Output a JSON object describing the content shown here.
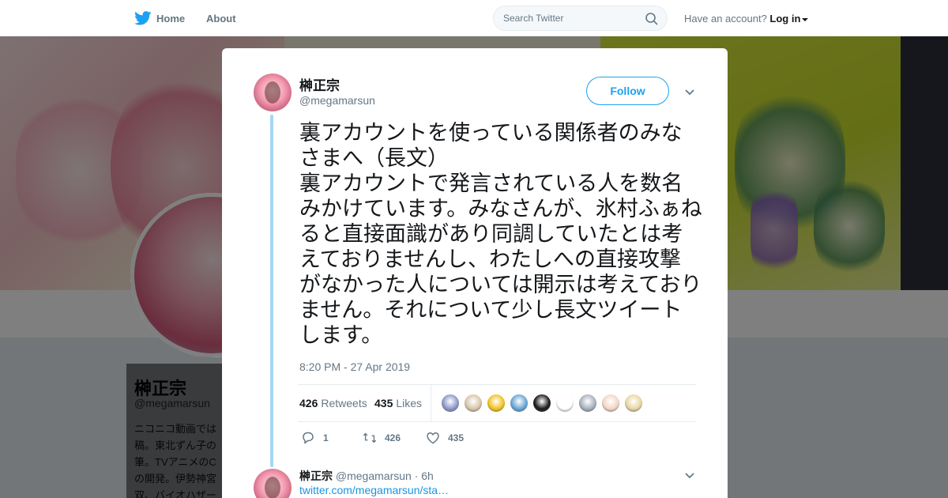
{
  "header": {
    "home_label": "Home",
    "about_label": "About",
    "search_placeholder": "Search Twitter",
    "have_account": "Have an account?",
    "login_label": "Log in"
  },
  "profile": {
    "name": "榊正宗",
    "handle": "@megamarsun",
    "bio_lines": [
      "ニコニコ動画では",
      "稿。東北ずん子の",
      "筆。TVアニメのC",
      "の開発。伊勢神宮",
      "双、バイオハザー"
    ]
  },
  "tweet": {
    "author_name": "榊正宗",
    "author_handle": "@megamarsun",
    "follow_label": "Follow",
    "text": "裏アカウントを使っている関係者のみなさまへ（長文）\n裏アカウントで発言されている人を数名みかけています。みなさんが、氷村ふぁねると直接面識があり同調していたとは考えておりませんし、わたしへの直接攻撃がなかった人については開示は考えておりません。それについて少し長文ツイートします。",
    "timestamp": "8:20 PM - 27 Apr 2019",
    "retweets_count": "426",
    "retweets_label": "Retweets",
    "likes_count": "435",
    "likes_label": "Likes",
    "actions": {
      "reply_count": "1",
      "retweet_count": "426",
      "like_count": "435"
    }
  },
  "reply": {
    "author_name": "榊正宗",
    "author_handle": "@megamarsun",
    "age": "· 6h",
    "link": "twitter.com/megamarsun/sta…"
  },
  "colors": {
    "accent": "#1da1f2",
    "thread_line": "#a3d7f7",
    "muted": "#657786"
  },
  "likers": [
    {
      "icon": "liker-avatar-1",
      "color": "#8d98c8"
    },
    {
      "icon": "liker-avatar-2",
      "color": "#d9c6a9"
    },
    {
      "icon": "liker-avatar-3",
      "color": "#f2c322"
    },
    {
      "icon": "liker-avatar-4",
      "color": "#6aa6d6"
    },
    {
      "icon": "liker-avatar-5",
      "color": "#1a1a1a"
    },
    {
      "icon": "liker-avatar-6",
      "color": "#ffffff"
    },
    {
      "icon": "liker-avatar-7",
      "color": "#a7b1bb"
    },
    {
      "icon": "liker-avatar-8",
      "color": "#f3d7c3"
    },
    {
      "icon": "liker-avatar-9",
      "color": "#e8d7a2"
    }
  ]
}
